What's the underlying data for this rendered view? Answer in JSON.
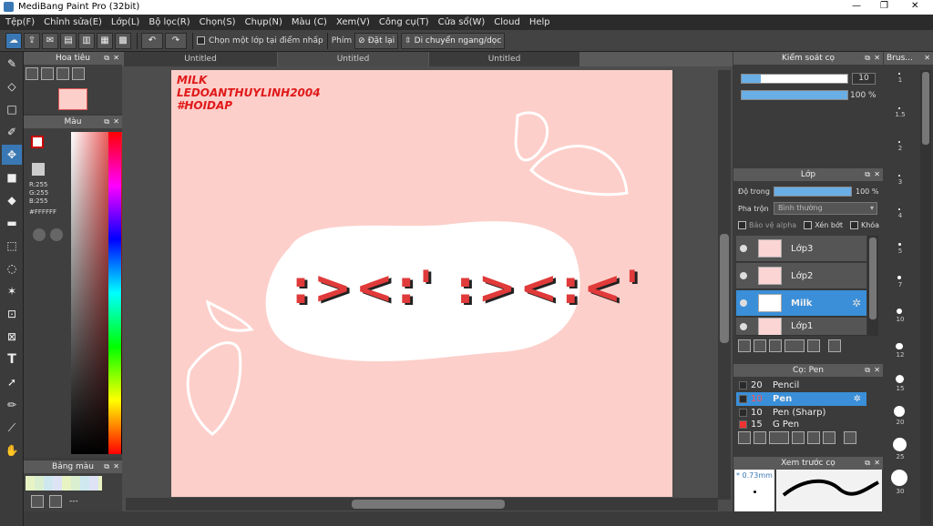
{
  "window": {
    "title": "MediBang Paint Pro (32bit)",
    "minimize": "—",
    "maximize": "❐",
    "close": "✕"
  },
  "menu": [
    "Tệp(F)",
    "Chỉnh sửa(E)",
    "Lớp(L)",
    "Bộ lọc(R)",
    "Chọn(S)",
    "Chụp(N)",
    "Màu (C)",
    "Xem(V)",
    "Công cụ(T)",
    "Cửa sổ(W)",
    "Cloud",
    "Help"
  ],
  "toolbar": {
    "select_layer_label": "Chọn một lớp tại điểm nhấp",
    "key_label": "Phím",
    "reset_label": "Đặt lại",
    "flip_label": "Di chuyển ngang/dọc"
  },
  "tabs": [
    "Untitled",
    "Untitled",
    "Untitled"
  ],
  "navigator": {
    "title": "Hoa tiêu"
  },
  "color_panel": {
    "title": "Màu",
    "r": "R:255",
    "g": "G:255",
    "b": "B:255",
    "hex": "#FFFFFF"
  },
  "palette": {
    "title": "Bảng màu",
    "name": "---"
  },
  "canvas": {
    "text_line1": "MILK",
    "text_line2": "LEDOANTHUYLINH2004",
    "text_line3": "#HOIDAP",
    "face_text": ":><:' :><:<'"
  },
  "brush_control": {
    "title": "Kiểm soát cọ",
    "size": "10",
    "opacity": "100 %",
    "size_fraction": 0.18,
    "opacity_fraction": 1.0
  },
  "layers": {
    "title": "Lớp",
    "opacity_label": "Độ trong",
    "opacity_value": "100 %",
    "blend_label": "Pha trộn",
    "blend_value": "Bình thường",
    "protect_alpha": "Bảo vệ alpha",
    "clipping": "Xén bớt",
    "lock": "Khóa",
    "items": [
      {
        "name": "Lớp3"
      },
      {
        "name": "Lớp2"
      },
      {
        "name": "Milk"
      },
      {
        "name": "Lớp1"
      }
    ]
  },
  "brushes": {
    "title": "Cọ: Pen",
    "items": [
      {
        "size": "20",
        "name": "Pencil"
      },
      {
        "size": "10",
        "name": "Pen"
      },
      {
        "size": "10",
        "name": "Pen (Sharp)"
      },
      {
        "size": "15",
        "name": "G Pen"
      }
    ]
  },
  "brush_preview": {
    "title": "Xem trước cọ",
    "size": "* 0.73mm"
  },
  "brush_sizes": {
    "title": "Brus...",
    "values": [
      "1",
      "1.5",
      "2",
      "3",
      "4",
      "5",
      "7",
      "10",
      "12",
      "15",
      "20",
      "25",
      "30"
    ]
  },
  "colors": {
    "accent": "#3a8fd8",
    "canvas_bg": "#fdcfca",
    "text_red": "#e01a1a"
  }
}
